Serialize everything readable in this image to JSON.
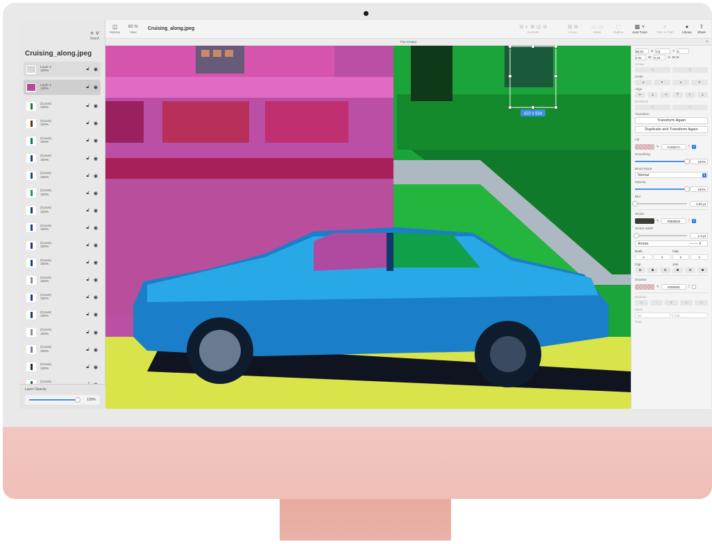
{
  "app": {
    "document_title": "Cruising_along.jpeg",
    "canvas_label": "The Creator",
    "dimensions_badge": "410 x 534"
  },
  "sidebar": {
    "insert_label": "Insert",
    "title": "Cruising_along.jpeg",
    "layers": [
      {
        "name": "Layer 2",
        "opacity": "100%",
        "kind": "group",
        "thumb_color": "#d8d8d8"
      },
      {
        "name": "Layer 1",
        "opacity": "100%",
        "kind": "selected",
        "thumb_color": "#b04a9a"
      },
      {
        "name": "(Curve)",
        "opacity": "100%",
        "thumb_color": "#1d7a2a"
      },
      {
        "name": "(Curve)",
        "opacity": "100%",
        "thumb_color": "#6a2a12"
      },
      {
        "name": "(Curve)",
        "opacity": "100%",
        "thumb_color": "#0f7a4c"
      },
      {
        "name": "(Curve)",
        "opacity": "100%",
        "thumb_color": "#1b3f80"
      },
      {
        "name": "(Curve)",
        "opacity": "100%",
        "thumb_color": "#1c4a8a"
      },
      {
        "name": "(Curve)",
        "opacity": "100%",
        "thumb_color": "#1fa055"
      },
      {
        "name": "(Curve)",
        "opacity": "100%",
        "thumb_color": "#1a3a7a"
      },
      {
        "name": "(Curve)",
        "opacity": "100%",
        "thumb_color": "#1d3f86"
      },
      {
        "name": "(Curve)",
        "opacity": "100%",
        "thumb_color": "#163a78"
      },
      {
        "name": "(Curve)",
        "opacity": "100%",
        "thumb_color": "#1b4288"
      },
      {
        "name": "(Curve)",
        "opacity": "100%",
        "thumb_color": "#8a8a9a"
      },
      {
        "name": "(Curve)",
        "opacity": "100%",
        "thumb_color": "#1c3f82"
      },
      {
        "name": "(Curve)",
        "opacity": "100%",
        "thumb_color": "#1a3c7c"
      },
      {
        "name": "(Curve)",
        "opacity": "100%",
        "thumb_color": "#8c8c8c"
      },
      {
        "name": "(Curve)",
        "opacity": "100%",
        "thumb_color": "#7a7aa8"
      },
      {
        "name": "(Curve)",
        "opacity": "100%",
        "thumb_color": "#2a2a2a"
      },
      {
        "name": "(Curve)",
        "opacity": "100%",
        "thumb_color": "#167a2a"
      }
    ],
    "layer_opacity_label": "Layer Opacity",
    "layer_opacity_value": "100%",
    "layer_opacity_fraction": 1.0
  },
  "toolbar": {
    "sidebar_label": "Sidebar",
    "view_label": "View",
    "zoom": "60 %",
    "boolean_label": "Boolean",
    "group_label": "Group",
    "mask_label": "Mask",
    "outline_label": "Outline",
    "auto_trace_label": "Auto Trace",
    "text_on_path_label": "Text on Path",
    "library_label": "Library",
    "share_label": "Share"
  },
  "inspector": {
    "geometry": {
      "x": "86.52",
      "x_label": "X",
      "y": "3.5",
      "y_label": "Y",
      "r": "0",
      "w_label": "W",
      "w": "2.61",
      "h_label": "H",
      "h": "0.45"
    },
    "group_label": "Group",
    "order_label": "Order",
    "align_label": "Align",
    "distribute_label": "Distribute",
    "transform_label": "Transform",
    "transform_again": "Transform Again",
    "duplicate_transform": "Duplicate and Transform Again",
    "fill_label": "Fill",
    "fill_hex": "#193D7A",
    "fill_color": "#193d7a",
    "smoothing_label": "Smoothing",
    "smoothing_value": "100%",
    "smoothing_fraction": 1.0,
    "blend_mode_label": "Blend Mode",
    "blend_mode_value": "Normal",
    "opacity_label": "Opacity",
    "opacity_value": "100%",
    "opacity_fraction": 1.0,
    "blur_label": "Blur",
    "blur_value": "0.00 pt",
    "blur_fraction": 0.0,
    "stroke_label": "Stroke",
    "stroke_hex": "#8B8B83",
    "stroke_color": "#3a3a36",
    "stroke_width_label": "Stroke Width",
    "stroke_width_value": "1.0 pt",
    "stroke_width_fraction": 0.02,
    "arrows_label": "Arrows",
    "dash_label": "Dash",
    "gap_label": "Gap",
    "dash_values": [
      "0",
      "0",
      "0",
      "0"
    ],
    "cap_label": "Cap",
    "join_label": "Join",
    "shadow_label": "Shadow",
    "shadow_hex": "#000000",
    "boolean_label": "Boolean",
    "mask_label": "Mask",
    "path_label": "Path",
    "mask_set": "Set",
    "mask_edit": "Edit"
  }
}
